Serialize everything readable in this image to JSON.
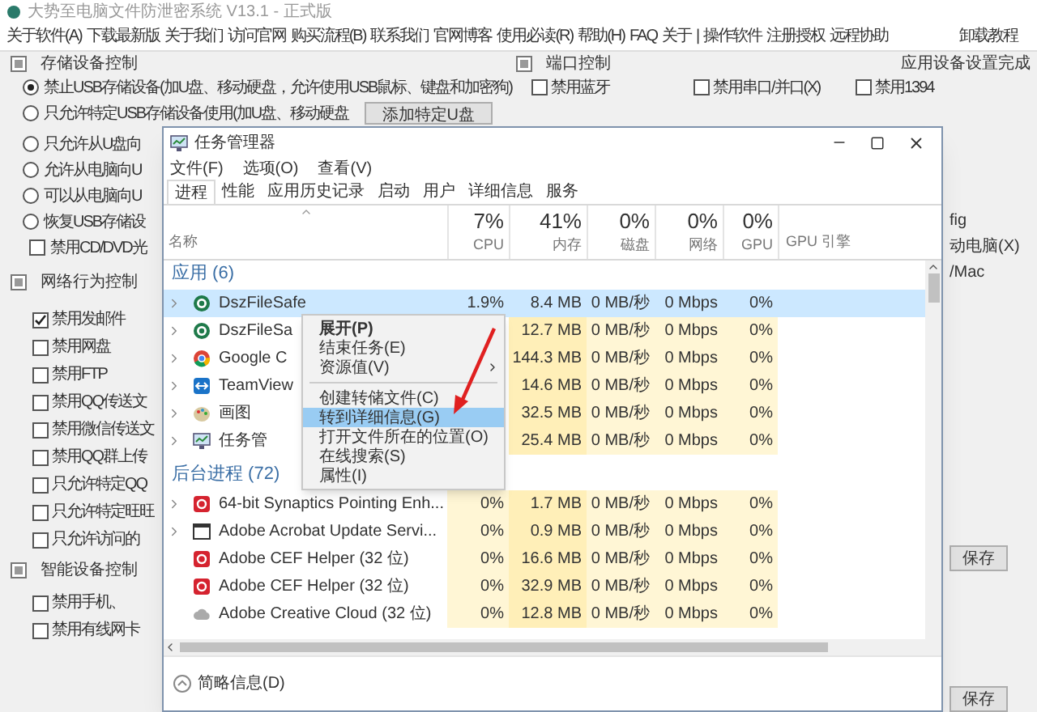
{
  "app": {
    "title": "大势至电脑文件防泄密系统 V13.1 - 正式版",
    "menu": [
      "关于软件(A)",
      "下载最新版",
      "关于我们",
      "访问官网",
      "购买流程(B)",
      "联系我们",
      "官网博客",
      "使用必读(R)",
      "帮助(H)",
      "FAQ",
      "关于",
      "|",
      "操作软件",
      "注册授权",
      "远程协助"
    ],
    "menu_right": "卸载教程"
  },
  "storage_panel": {
    "title": "存储设备控制",
    "add_button": "添加特定U盘",
    "options": [
      {
        "kind": "radio",
        "label": "禁止USB存储设备(加U盘、移动硬盘，允许使用USB鼠标、键盘和加密狗)",
        "selected": true
      },
      {
        "kind": "radio",
        "label": "只允许特定USB存储设备使用(加U盘、移动硬盘",
        "selected": false
      },
      {
        "kind": "radio",
        "label": "只允许从U盘向",
        "selected": false
      },
      {
        "kind": "radio",
        "label": "允许从电脑向U",
        "selected": false
      },
      {
        "kind": "radio",
        "label": "可以从电脑向U",
        "selected": false
      },
      {
        "kind": "radio",
        "label": "恢复USB存储设",
        "selected": false
      },
      {
        "kind": "checkbox",
        "label": "禁用CD/DVD光",
        "checked": false
      }
    ]
  },
  "network_panel": {
    "title": "网络行为控制",
    "options": [
      {
        "label": "禁用发邮件",
        "checked": true
      },
      {
        "label": "禁用网盘",
        "checked": false
      },
      {
        "label": "禁用FTP",
        "checked": false
      },
      {
        "label": "禁用QQ传送文",
        "checked": false
      },
      {
        "label": "禁用微信传送文",
        "checked": false
      },
      {
        "label": "禁用QQ群上传",
        "checked": false
      },
      {
        "label": "只允许特定QQ",
        "checked": false
      },
      {
        "label": "只允许特定旺旺",
        "checked": false
      },
      {
        "label": "只允许访问的",
        "checked": false
      }
    ]
  },
  "smart_panel": {
    "title": "智能设备控制",
    "options": [
      {
        "label": "禁用手机、",
        "checked": false
      },
      {
        "label": "禁用有线网卡",
        "checked": false
      }
    ]
  },
  "port_panel": {
    "title": "端口控制",
    "status": "应用设备设置完成",
    "options": [
      {
        "label": "禁用蓝牙",
        "checked": false
      },
      {
        "label": "禁用串口/并口(X)",
        "checked": false
      },
      {
        "label": "禁用1394",
        "checked": false
      }
    ]
  },
  "side_texts": [
    "fig",
    "动电脑(X)",
    "/Mac"
  ],
  "save_buttons": [
    "保存",
    "保存"
  ],
  "task_manager": {
    "title": "任务管理器",
    "menu": [
      "文件(F)",
      "选项(O)",
      "查看(V)"
    ],
    "tabs": [
      {
        "label": "进程",
        "selected": true
      },
      {
        "label": "性能",
        "selected": false
      },
      {
        "label": "应用历史记录",
        "selected": false
      },
      {
        "label": "启动",
        "selected": false
      },
      {
        "label": "用户",
        "selected": false
      },
      {
        "label": "详细信息",
        "selected": false
      },
      {
        "label": "服务",
        "selected": false
      }
    ],
    "columns": [
      {
        "label": "名称"
      },
      {
        "usage": "7%",
        "label": "CPU"
      },
      {
        "usage": "41%",
        "label": "内存"
      },
      {
        "usage": "0%",
        "label": "磁盘"
      },
      {
        "usage": "0%",
        "label": "网络"
      },
      {
        "usage": "0%",
        "label": "GPU"
      },
      {
        "label": "GPU 引擎"
      }
    ],
    "groups": [
      {
        "title": "应用 (6)",
        "rows": [
          {
            "name": "DszFileSafe",
            "expandable": true,
            "selected": true,
            "cpu": "1.9%",
            "memory": "8.4 MB",
            "disk": "0 MB/秒",
            "network": "0 Mbps",
            "gpu": "0%"
          },
          {
            "name": "DszFileSa",
            "expandable": true,
            "selected": false,
            "memory": "12.7 MB",
            "disk": "0 MB/秒",
            "network": "0 Mbps",
            "gpu": "0%"
          },
          {
            "name": "Google C",
            "expandable": true,
            "selected": false,
            "memory": "144.3 MB",
            "disk": "0 MB/秒",
            "network": "0 Mbps",
            "gpu": "0%"
          },
          {
            "name": "TeamView",
            "expandable": true,
            "selected": false,
            "memory": "14.6 MB",
            "disk": "0 MB/秒",
            "network": "0 Mbps",
            "gpu": "0%"
          },
          {
            "name": "画图",
            "expandable": true,
            "selected": false,
            "memory": "32.5 MB",
            "disk": "0 MB/秒",
            "network": "0 Mbps",
            "gpu": "0%"
          },
          {
            "name": "任务管",
            "expandable": true,
            "selected": false,
            "memory": "25.4 MB",
            "disk": "0 MB/秒",
            "network": "0 Mbps",
            "gpu": "0%"
          }
        ]
      },
      {
        "title": "后台进程 (72)",
        "rows": [
          {
            "name": "64-bit Synaptics Pointing Enh...",
            "expandable": true,
            "selected": false,
            "cpu": "0%",
            "memory": "1.7 MB",
            "disk": "0 MB/秒",
            "network": "0 Mbps",
            "gpu": "0%"
          },
          {
            "name": "Adobe Acrobat Update Servi...",
            "expandable": true,
            "selected": false,
            "cpu": "0%",
            "memory": "0.9 MB",
            "disk": "0 MB/秒",
            "network": "0 Mbps",
            "gpu": "0%"
          },
          {
            "name": "Adobe CEF Helper (32 位)",
            "expandable": false,
            "selected": false,
            "cpu": "0%",
            "memory": "16.6 MB",
            "disk": "0 MB/秒",
            "network": "0 Mbps",
            "gpu": "0%"
          },
          {
            "name": "Adobe CEF Helper (32 位)",
            "expandable": false,
            "selected": false,
            "cpu": "0%",
            "memory": "32.9 MB",
            "disk": "0 MB/秒",
            "network": "0 Mbps",
            "gpu": "0%"
          },
          {
            "name": "Adobe Creative Cloud (32 位)",
            "expandable": false,
            "selected": false,
            "cpu": "0%",
            "memory": "12.8 MB",
            "disk": "0 MB/秒",
            "network": "0 Mbps",
            "gpu": "0%"
          }
        ]
      }
    ],
    "footer": "简略信息(D)"
  },
  "context_menu": [
    {
      "kind": "item",
      "label": "展开(P)",
      "bold": true,
      "submenu": false,
      "selected": false
    },
    {
      "kind": "item",
      "label": "结束任务(E)",
      "bold": false,
      "submenu": false,
      "selected": false
    },
    {
      "kind": "item",
      "label": "资源值(V)",
      "bold": false,
      "submenu": true,
      "selected": false
    },
    {
      "kind": "separator"
    },
    {
      "kind": "item",
      "label": "创建转储文件(C)",
      "bold": false,
      "submenu": false,
      "selected": false
    },
    {
      "kind": "item",
      "label": "转到详细信息(G)",
      "bold": false,
      "submenu": false,
      "selected": true
    },
    {
      "kind": "item",
      "label": "打开文件所在的位置(O)",
      "bold": false,
      "submenu": false,
      "selected": false
    },
    {
      "kind": "item",
      "label": "在线搜索(S)",
      "bold": false,
      "submenu": false,
      "selected": false
    },
    {
      "kind": "item",
      "label": "属性(I)",
      "bold": false,
      "submenu": false,
      "selected": false
    }
  ]
}
